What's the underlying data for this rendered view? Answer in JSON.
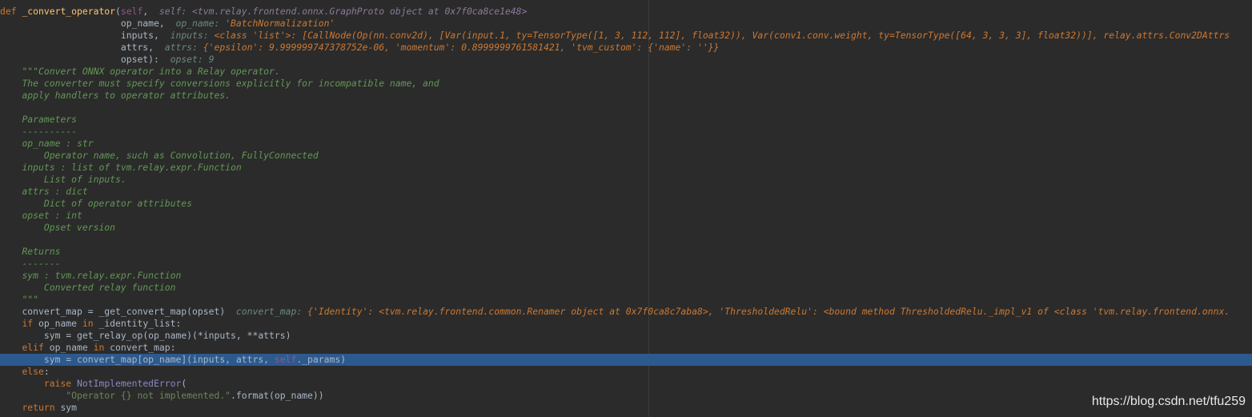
{
  "code": {
    "l1": {
      "def": "def ",
      "name": "_convert_operator",
      "paren": "(",
      "self": "self",
      "comma": ",  ",
      "hint": "self: <tvm.relay.frontend.onnx.GraphProto object at 0x7f0ca8ce1e48>"
    },
    "l2": {
      "param": "op_name",
      "comma": ",  ",
      "hint_label": "op_name: ",
      "hint_value": "'BatchNormalization'"
    },
    "l3": {
      "param": "inputs",
      "comma": ",  ",
      "hint_label": "inputs: ",
      "hint_value": "<class 'list'>: [CallNode(Op(nn.conv2d), [Var(input.1, ty=TensorType([1, 3, 112, 112], float32)), Var(conv1.conv.weight, ty=TensorType([64, 3, 3, 3], float32))], relay.attrs.Conv2DAttrs"
    },
    "l4": {
      "param": "attrs",
      "comma": ",  ",
      "hint_label": "attrs: ",
      "hint_value": "{'epsilon': 9.999999747378752e-06, 'momentum': 0.8999999761581421, 'tvm_custom': {'name': ''}}"
    },
    "l5": {
      "param": "opset",
      "close": "):",
      "hint_label": "opset: ",
      "hint_value": "9"
    },
    "doc": [
      "\"\"\"Convert ONNX operator into a Relay operator.",
      "The converter must specify conversions explicitly for incompatible name, and",
      "apply handlers to operator attributes.",
      "",
      "Parameters",
      "----------",
      "op_name : str",
      "    Operator name, such as Convolution, FullyConnected",
      "inputs : list of tvm.relay.expr.Function",
      "    List of inputs.",
      "attrs : dict",
      "    Dict of operator attributes",
      "opset : int",
      "    Opset version",
      "",
      "Returns",
      "-------",
      "sym : tvm.relay.expr.Function",
      "    Converted relay function",
      "\"\"\""
    ],
    "l26": {
      "code": "convert_map = _get_convert_map(opset)",
      "hint_label": "convert_map: ",
      "hint_value": "{'Identity': <tvm.relay.frontend.common.Renamer object at 0x7f0ca8c7aba8>, 'ThresholdedRelu': <bound method ThresholdedRelu._impl_v1 of <class 'tvm.relay.frontend.onnx."
    },
    "l27": {
      "kw": "if",
      "rest1": " op_name ",
      "kw2": "in",
      "rest2": " _identity_list:"
    },
    "l28": {
      "code": "sym = get_relay_op(op_name)(*inputs, **attrs)"
    },
    "l29": {
      "kw": "elif",
      "rest1": " op_name ",
      "kw2": "in",
      "rest2": " convert_map:"
    },
    "l30": {
      "code1": "sym = convert_map[op_name](inputs, attrs, ",
      "self": "self",
      "code2": "._params)"
    },
    "l31": {
      "kw": "else",
      "rest": ":"
    },
    "l32": {
      "kw": "raise",
      "sp": " ",
      "cls": "NotImplementedError",
      "paren": "("
    },
    "l33": {
      "str": "\"Operator {} not implemented.\"",
      "rest": ".format(op_name))"
    },
    "l34": {
      "kw": "return",
      "rest": " sym"
    }
  },
  "watermark": "https://blog.csdn.net/tfu259",
  "colors": {
    "background": "#2b2b2b",
    "keyword": "#cc7832",
    "function": "#ffc66d",
    "docstring": "#629755",
    "current_line": "#2d5a8e"
  }
}
